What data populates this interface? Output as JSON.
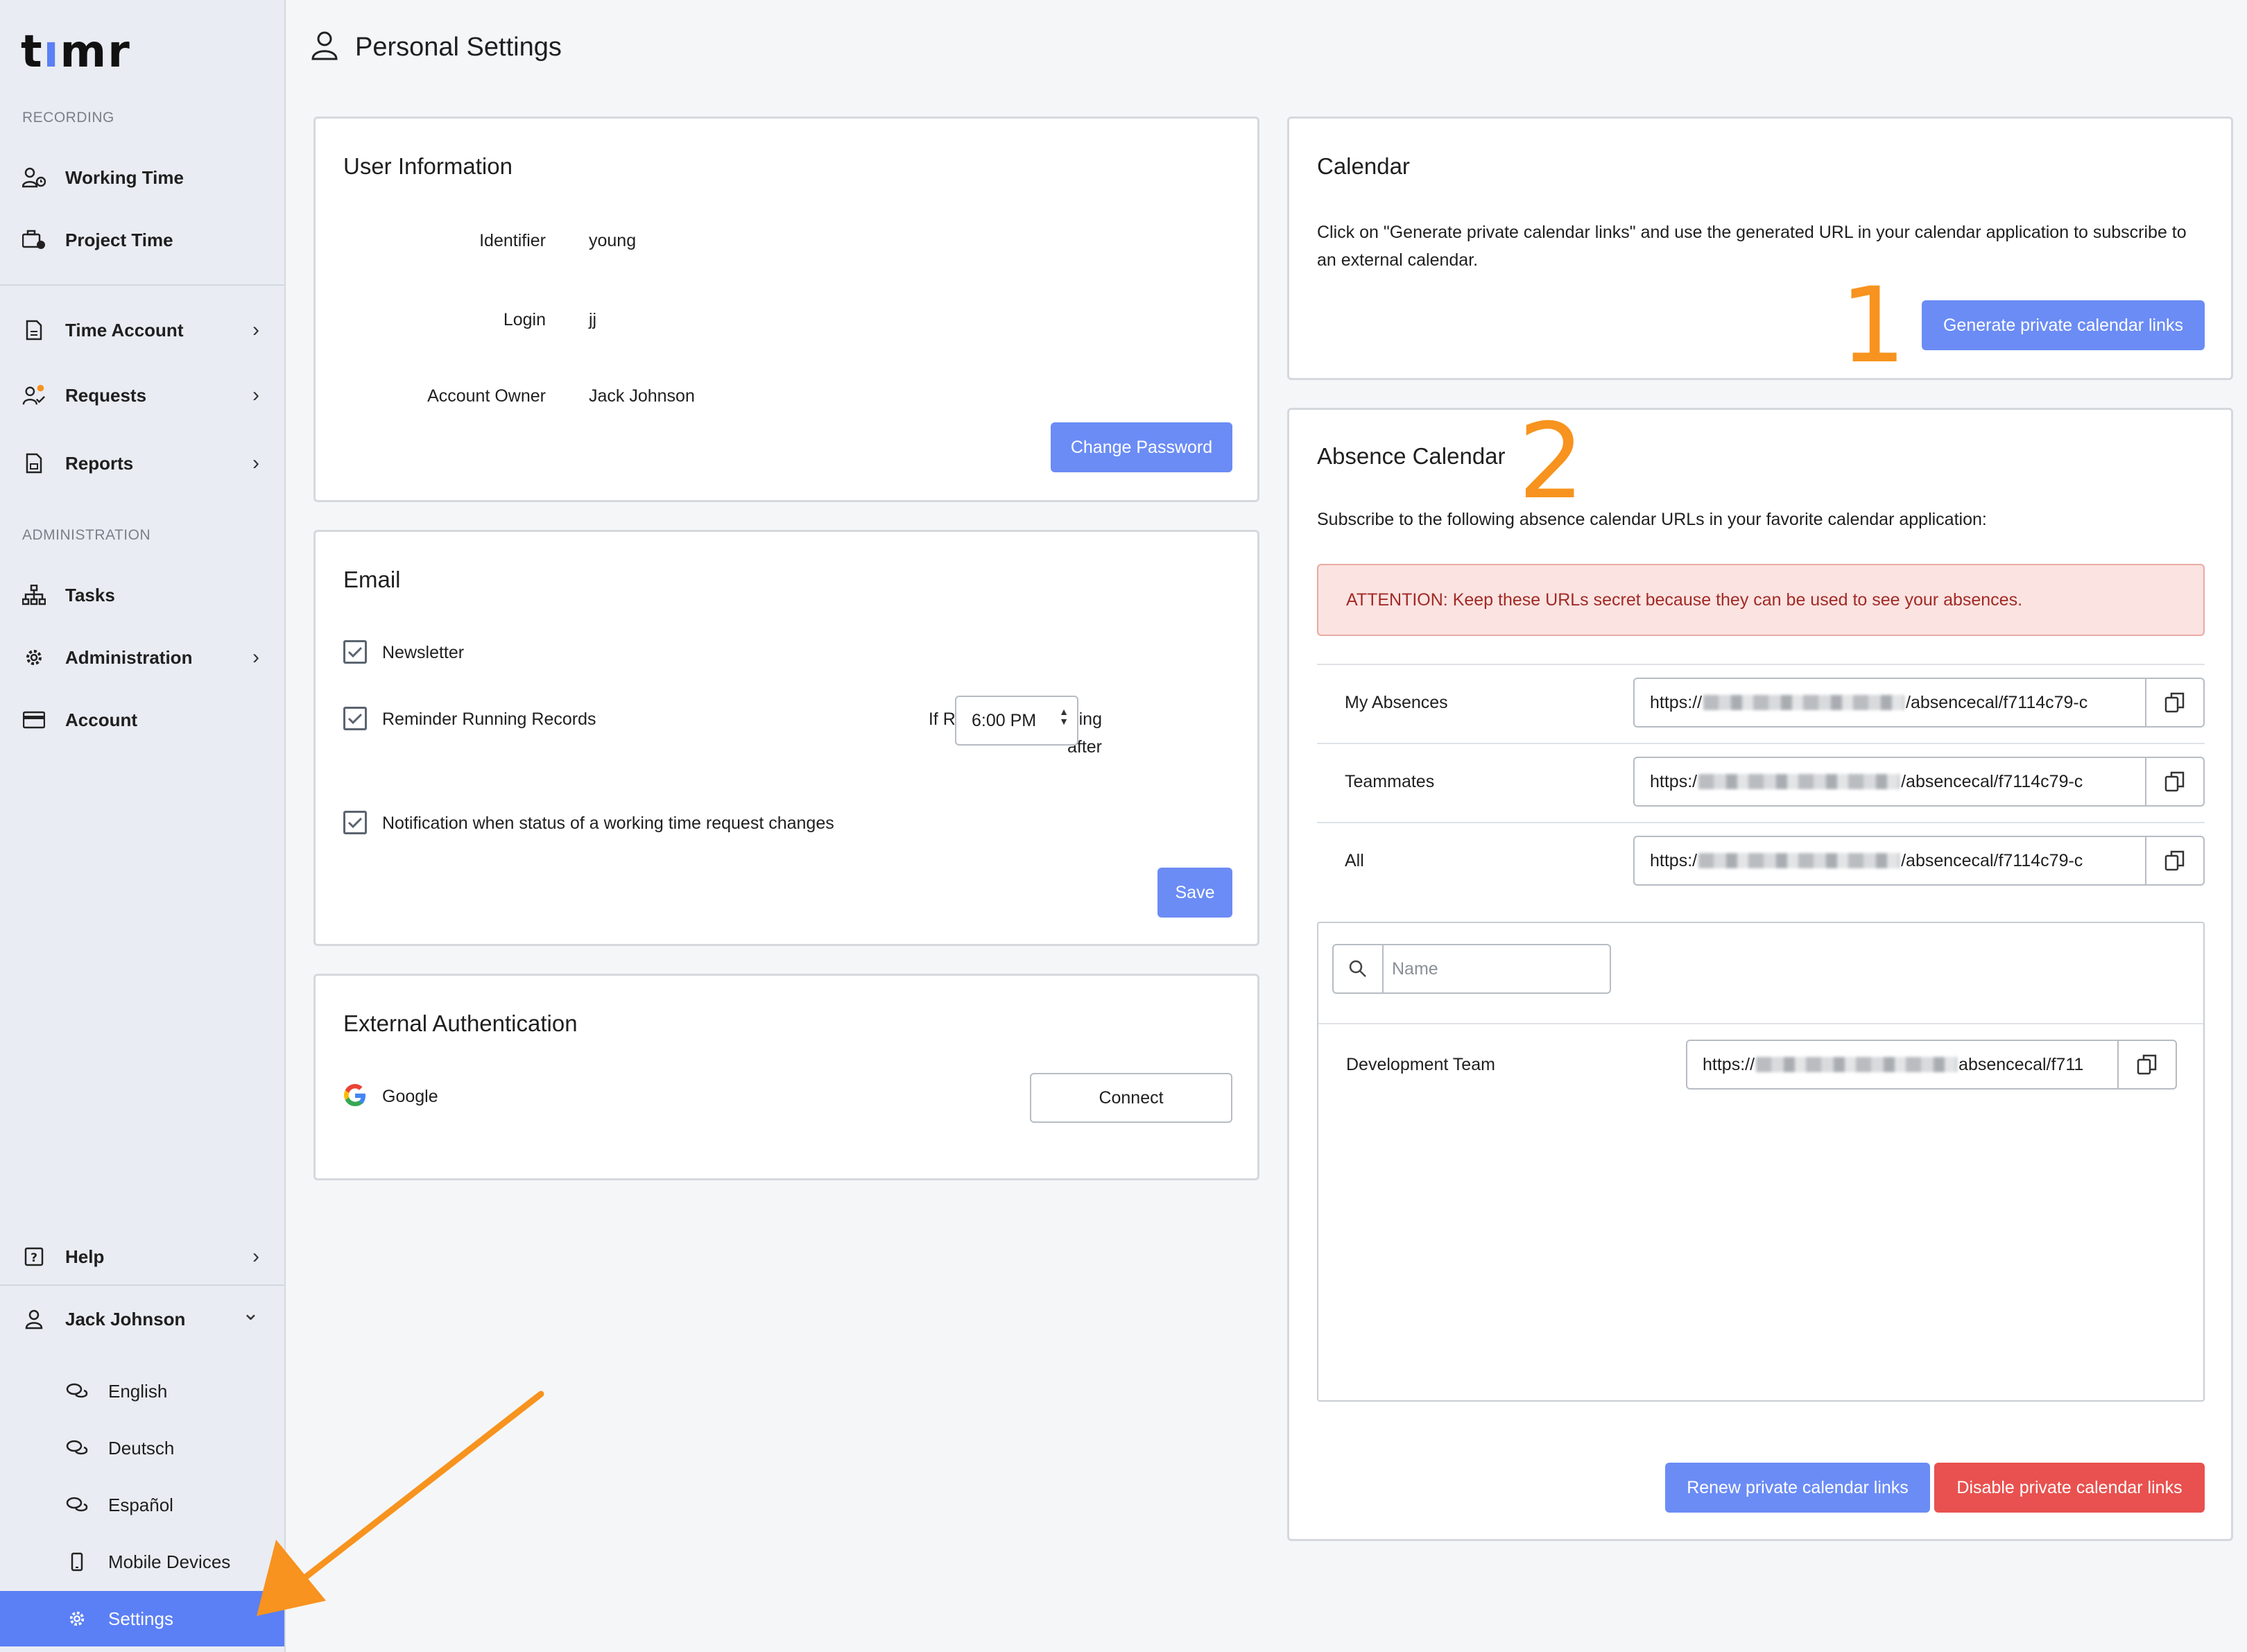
{
  "sidebar": {
    "logo": {
      "t": "t",
      "i": "ı",
      "mr": "mr"
    },
    "recording_label": "RECORDING",
    "administration_label": "ADMINISTRATION",
    "items": {
      "working_time": "Working Time",
      "project_time": "Project Time",
      "time_account": "Time Account",
      "requests": "Requests",
      "reports": "Reports",
      "tasks": "Tasks",
      "administration": "Administration",
      "account": "Account",
      "help": "Help",
      "user": "Jack Johnson",
      "english": "English",
      "deutsch": "Deutsch",
      "espanol": "Español",
      "mobile_devices": "Mobile Devices",
      "settings": "Settings"
    },
    "chevron": "›",
    "chevron_down": "⌄"
  },
  "header": {
    "title": "Personal Settings"
  },
  "user_info": {
    "title": "User Information",
    "identifier_label": "Identifier",
    "identifier_value": "young",
    "login_label": "Login",
    "login_value": "jj",
    "owner_label": "Account Owner",
    "owner_value": "Jack Johnson",
    "change_password": "Change Password"
  },
  "email": {
    "title": "Email",
    "newsletter": "Newsletter",
    "reminder": "Reminder Running Records",
    "if_running_line1": "If Recording is running",
    "if_running_line2": "after",
    "time_value": "6:00 PM",
    "notification": "Notification when status of a working time request changes",
    "save": "Save",
    "newsletter_checked": true,
    "reminder_checked": true,
    "notification_checked": true
  },
  "external_auth": {
    "title": "External Authentication",
    "provider": "Google",
    "connect": "Connect"
  },
  "calendar": {
    "title": "Calendar",
    "description": "Click on \"Generate private calendar links\" and use the generated URL in your calendar application to subscribe to an external calendar.",
    "generate": "Generate private calendar links",
    "annotation": "1"
  },
  "absence_calendar": {
    "title": "Absence Calendar",
    "annotation": "2",
    "description": "Subscribe to the following absence calendar URLs in your favorite calendar application:",
    "attention": "ATTENTION: Keep these URLs secret because they can be used to see your absences.",
    "rows": [
      {
        "label": "My Absences",
        "url_start": "https://",
        "url_end": "/absencecal/f7114c79-c"
      },
      {
        "label": "Teammates",
        "url_start": "https:/",
        "url_end": "/absencecal/f7114c79-c"
      },
      {
        "label": "All",
        "url_start": "https:/",
        "url_end": "/absencecal/f7114c79-c"
      }
    ],
    "search_placeholder": "Name",
    "team": {
      "label": "Development Team",
      "url_start": "https://",
      "url_end": "absencecal/f711"
    },
    "renew": "Renew private calendar links",
    "disable": "Disable private calendar links"
  },
  "colors": {
    "accent": "#5b7ff5",
    "danger": "#e8514f",
    "annotation": "#f7931e"
  }
}
